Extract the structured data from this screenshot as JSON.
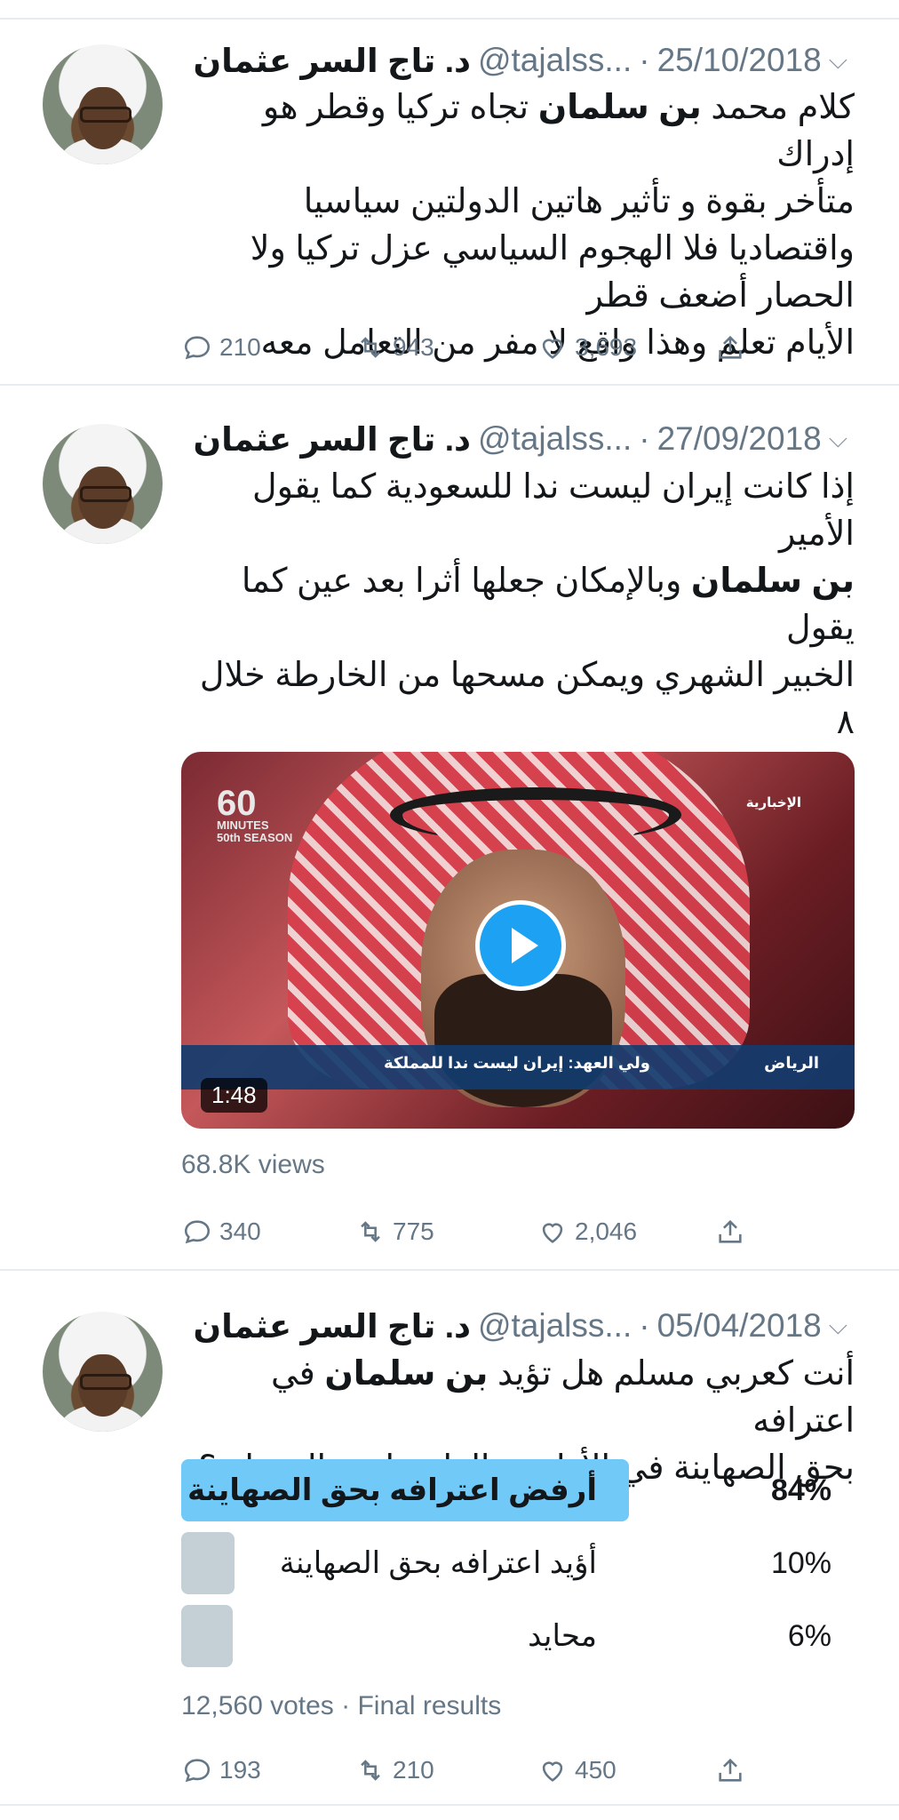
{
  "tweets": [
    {
      "name": "د. تاج السر عثمان",
      "handle": "@tajalss...",
      "date": "25/10/2018",
      "text_html": "كلام محمد <b>بن سلمان</b> تجاه تركيا وقطر هو إدراك<br>متأخر بقوة و تأثير هاتين الدولتين سياسيا<br>واقتصاديا فلا الهجوم السياسي عزل تركيا ولا<br>الحصار أضعف قطر<br>الأيام تعلم وهذا واقع لا مفر من التعامل معه",
      "replies": "210",
      "retweets": "943",
      "likes": "3,693"
    },
    {
      "name": "د. تاج السر عثمان",
      "handle": "@tajalss...",
      "date": "27/09/2018",
      "text_html": "إذا كانت إيران ليست ندا للسعودية كما يقول الأمير<br><b>بن سلمان</b> وبالإمكان جعلها أثرا بعد عين كما يقول<br>الخبير الشهري ويمكن مسحها من الخارطة خلال ٨<br>ساعات كما يقول الخبير الوقاع فما الداعي للهرولة<br>إلى إسرائيل والإصطفاف معها تحت ذريعة مواجهة<br>إيران ؟",
      "video": {
        "duration": "1:48",
        "views": "68.8K views",
        "logo": "60",
        "logo_sub": "MINUTES",
        "logo_season": "50th SEASON",
        "channel": "الإخبارية",
        "caption": "ولي العهد: إيران ليست ندا للمملكة",
        "location": "الرياض"
      },
      "replies": "340",
      "retweets": "775",
      "likes": "2,046"
    },
    {
      "name": "د. تاج السر عثمان",
      "handle": "@tajalss...",
      "date": "05/04/2018",
      "text_html": "أنت كعربي مسلم هل تؤيد <b>بن سلمان</b> في اعترافه<br>بحق الصهاينة في الأراضي الفلسطينية المحتلة ؟",
      "poll": {
        "options": [
          {
            "label": "أرفض اعترافه بحق الصهاينة",
            "percent": "84%",
            "share": 0.84,
            "winner": true
          },
          {
            "label": "أؤيد اعترافه بحق الصهاينة",
            "percent": "10%",
            "share": 0.1,
            "winner": false
          },
          {
            "label": "محايد",
            "percent": "6%",
            "share": 0.06,
            "winner": false
          }
        ],
        "votes": "12,560 votes",
        "status": "Final results"
      },
      "replies": "193",
      "retweets": "210",
      "likes": "450"
    }
  ],
  "colors": {
    "accent": "#1da1f2",
    "poll_winner": "#71c9f8",
    "poll_other": "#c4cfd6",
    "muted": "#657786"
  }
}
